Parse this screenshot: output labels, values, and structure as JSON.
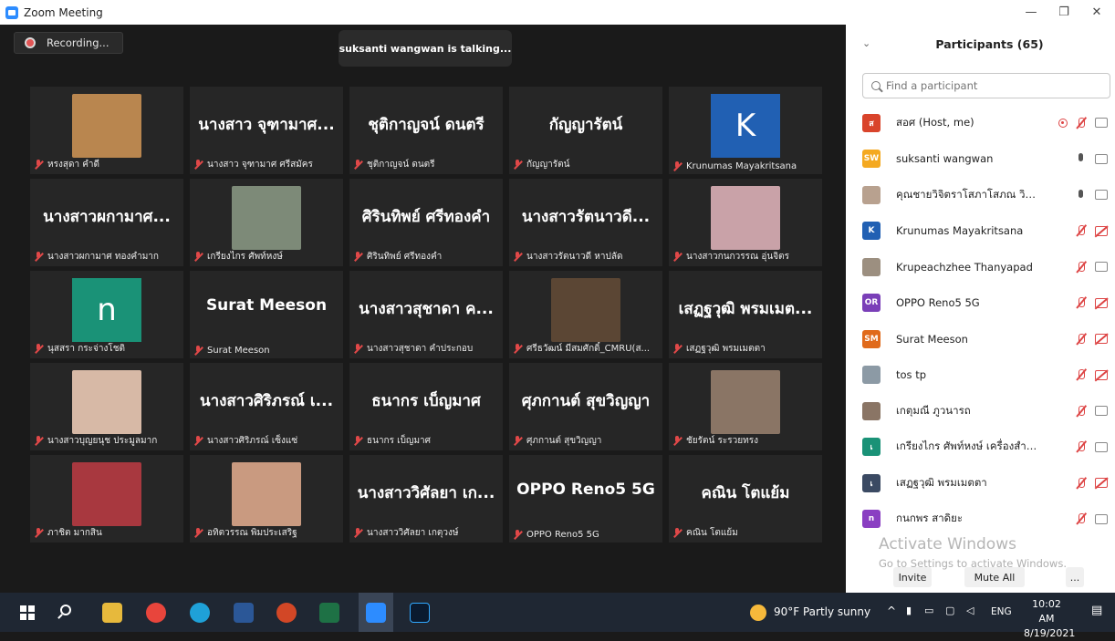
{
  "window": {
    "title": "Zoom Meeting"
  },
  "meeting": {
    "recording_label": "Recording...",
    "talking": "suksanti wangwan is talking...",
    "tiles": [
      {
        "big": "",
        "name": "หรงสุดา คำดี",
        "avatar": "photo",
        "color": "#b9864f"
      },
      {
        "big": "นางสาว จุฑามาศ...",
        "name": "นางสาว จุฑามาศ ศรีสมัคร"
      },
      {
        "big": "ชุติกาญจน์ ดนตรี",
        "name": "ชุติกาญจน์ ดนตรี"
      },
      {
        "big": "กัญญารัตน์",
        "name": "กัญญารัตน์"
      },
      {
        "big": "",
        "name": "Krunumas Mayakritsana",
        "avatar": "letter",
        "letter": "K",
        "color": "#2160b3"
      },
      {
        "big": "นางสาวผกามาศ...",
        "name": "นางสาวผกามาศ ทองคำมาก"
      },
      {
        "big": "",
        "name": "เกรียงไกร ศัพท์หงษ์",
        "avatar": "photo",
        "color": "#7d8a78"
      },
      {
        "big": "ศิรินทิพย์ ศรีทองคำ",
        "name": "ศิรินทิพย์ ศรีทองคำ"
      },
      {
        "big": "นางสาวรัตนาวดี...",
        "name": "นางสาวรัตนาวดี หาปลัด"
      },
      {
        "big": "",
        "name": "นางสาวกนกวรรณ อุ่นจิตร",
        "avatar": "photo",
        "color": "#c9a2a8"
      },
      {
        "big": "",
        "name": "นุสสรา กระจ่างโชติ",
        "avatar": "letter",
        "letter": "n",
        "color": "#1a9277"
      },
      {
        "big": "Surat Meeson",
        "name": "Surat Meeson",
        "latin": true
      },
      {
        "big": "นางสาวสุชาดา ค...",
        "name": "นางสาวสุชาดา คำประกอบ"
      },
      {
        "big": "",
        "name": "ศรีธวัฒน์ มีสมศักดิ์_CMRU(ส...",
        "avatar": "photo",
        "color": "#5b4634"
      },
      {
        "big": "เสฏฐวุฒิ พรมเมต...",
        "name": "เสฏฐวุฒิ พรมเมตตา"
      },
      {
        "big": "",
        "name": "นางสาวบุญยนุช ประมูลมาก",
        "avatar": "photo",
        "color": "#d7b9a6"
      },
      {
        "big": "นางสาวศิริภรณ์ เ...",
        "name": "นางสาวศิริภรณ์ เซ็งแซ่"
      },
      {
        "big": "ธนากร เบ็ญมาศ",
        "name": "ธนากร เบ็ญมาศ"
      },
      {
        "big": "ศุภกานต์ สุขวิญญา",
        "name": "ศุภกานต์ สุขวิญญา"
      },
      {
        "big": "",
        "name": "ชัยรัตน์ ระรวยทรง",
        "avatar": "photo",
        "color": "#8a7565"
      },
      {
        "big": "",
        "name": "ภาชิต มากสิน",
        "avatar": "photo",
        "color": "#a8383f"
      },
      {
        "big": "",
        "name": "อทิตวรรณ พิมประเสริฐ",
        "avatar": "photo",
        "color": "#c99a80"
      },
      {
        "big": "นางสาววิศัลยา เก...",
        "name": "นางสาววิศัลยา เกตุวงษ์"
      },
      {
        "big": "OPPO Reno5 5G",
        "name": "OPPO Reno5 5G",
        "latin": true
      },
      {
        "big": "คณิน โตแย้ม",
        "name": "คณิน โตแย้ม"
      }
    ]
  },
  "panel": {
    "title": "Participants (65)",
    "search_placeholder": "Find a participant",
    "participants": [
      {
        "initials": "ส",
        "color": "#d9442b",
        "name": "สอศ (Host, me)",
        "rec": true,
        "mic": "off",
        "video": "on"
      },
      {
        "initials": "SW",
        "color": "#f4a921",
        "name": "suksanti wangwan",
        "mic": "on",
        "video": "on"
      },
      {
        "initials": "",
        "color": "#b8a18f",
        "name": "คุณชายวิจิตราโสภาโสภณ วิมลรัตนรุ...",
        "mic": "on",
        "video": "on"
      },
      {
        "initials": "K",
        "color": "#2160b3",
        "name": "Krunumas Mayakritsana",
        "mic": "off",
        "video": "off"
      },
      {
        "initials": "",
        "color": "#9c8f80",
        "name": "Krupeachzhee Thanyapad",
        "mic": "off",
        "video": "on"
      },
      {
        "initials": "OR",
        "color": "#7a3fb8",
        "name": "OPPO Reno5 5G",
        "mic": "off",
        "video": "off"
      },
      {
        "initials": "SM",
        "color": "#e06a1b",
        "name": "Surat Meeson",
        "mic": "off",
        "video": "off"
      },
      {
        "initials": "",
        "color": "#8c9aa5",
        "name": "tos tp",
        "mic": "off",
        "video": "off"
      },
      {
        "initials": "",
        "color": "#8a7565",
        "name": "เกตุมณี ภูวนารถ",
        "mic": "off",
        "video": "on"
      },
      {
        "initials": "เ",
        "color": "#1a9277",
        "name": "เกรียงไกร ศัพท์หงษ์ เครื่องสำรอง",
        "mic": "off",
        "video": "on"
      },
      {
        "initials": "เ",
        "color": "#3b4a63",
        "name": "เสฏฐวุฒิ พรมเมตตา",
        "mic": "off",
        "video": "off"
      },
      {
        "initials": "n",
        "color": "#8a3fc2",
        "name": "กนกพร สาดิยะ",
        "mic": "off",
        "video": "on"
      }
    ],
    "watermark_title": "Activate Windows",
    "watermark_sub": "Go to Settings to activate Windows.",
    "invite_label": "Invite",
    "mute_all_label": "Mute All",
    "more_label": "..."
  },
  "taskbar": {
    "weather": "90°F  Partly sunny",
    "lang": "ENG",
    "time": "10:02 AM",
    "date": "8/19/2021"
  }
}
